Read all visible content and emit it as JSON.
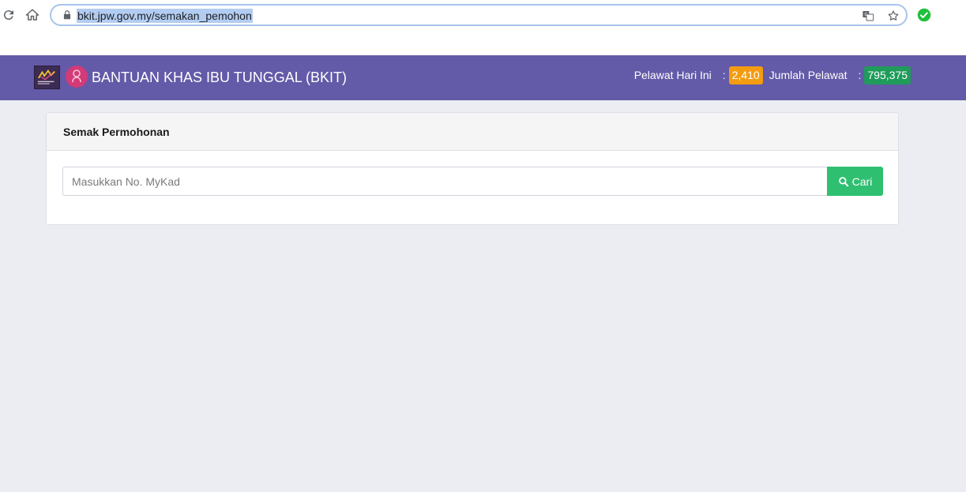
{
  "browser": {
    "url": "bkit.jpw.gov.my/semakan_pemohon"
  },
  "header": {
    "title": "BANTUAN KHAS IBU TUNGGAL (BKIT)",
    "visitors_today_label": "Pelawat Hari Ini",
    "visitors_today_value": "2,410",
    "total_visitors_label": "Jumlah Pelawat",
    "total_visitors_value": "795,375",
    "colon": ":"
  },
  "panel": {
    "title": "Semak Permohonan",
    "search_placeholder": "Masukkan No. MyKad",
    "search_button_label": "Cari"
  },
  "colors": {
    "header_bg": "#635aa8",
    "badge_today": "#f39c12",
    "badge_total": "#1f9b5a",
    "search_button": "#2fbf71"
  },
  "icons": [
    "reload-icon",
    "home-icon",
    "lock-icon",
    "translate-icon",
    "star-icon",
    "extension-check-icon",
    "search-icon"
  ]
}
